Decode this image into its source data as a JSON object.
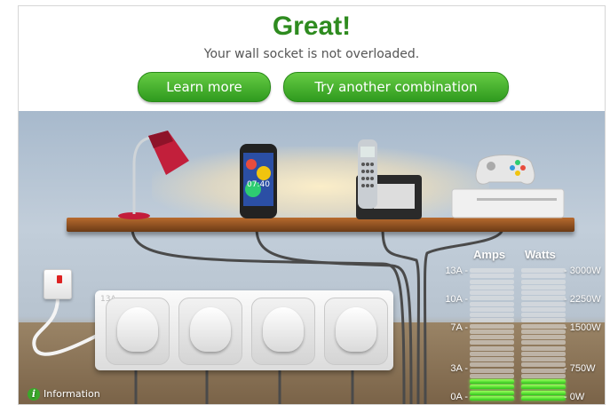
{
  "header": {
    "title": "Great!",
    "subtitle": "Your wall socket is not overloaded.",
    "learn_more": "Learn more",
    "try_another": "Try another combination"
  },
  "strip": {
    "rating": "13A"
  },
  "meter": {
    "amps_label": "Amps",
    "watts_label": "Watts",
    "amps_ticks": [
      "13A",
      "10A",
      "7A",
      "3A",
      "0A"
    ],
    "watts_ticks": [
      "3000W",
      "2250W",
      "1500W",
      "750W",
      "0W"
    ],
    "total_segments": 24,
    "lit_segments": 4
  },
  "devices": [
    {
      "name": "desk lamp",
      "icon": "lamp-icon"
    },
    {
      "name": "smartphone",
      "icon": "smartphone-icon",
      "screen_time": "07:40"
    },
    {
      "name": "cordless phone",
      "icon": "cordless-phone-icon"
    },
    {
      "name": "games console",
      "icon": "games-console-icon"
    }
  ],
  "info": {
    "label": "Information"
  },
  "colors": {
    "accent_green": "#2e8b1f",
    "button_green": "#3fae2a",
    "meter_on": "#3fd41f"
  }
}
